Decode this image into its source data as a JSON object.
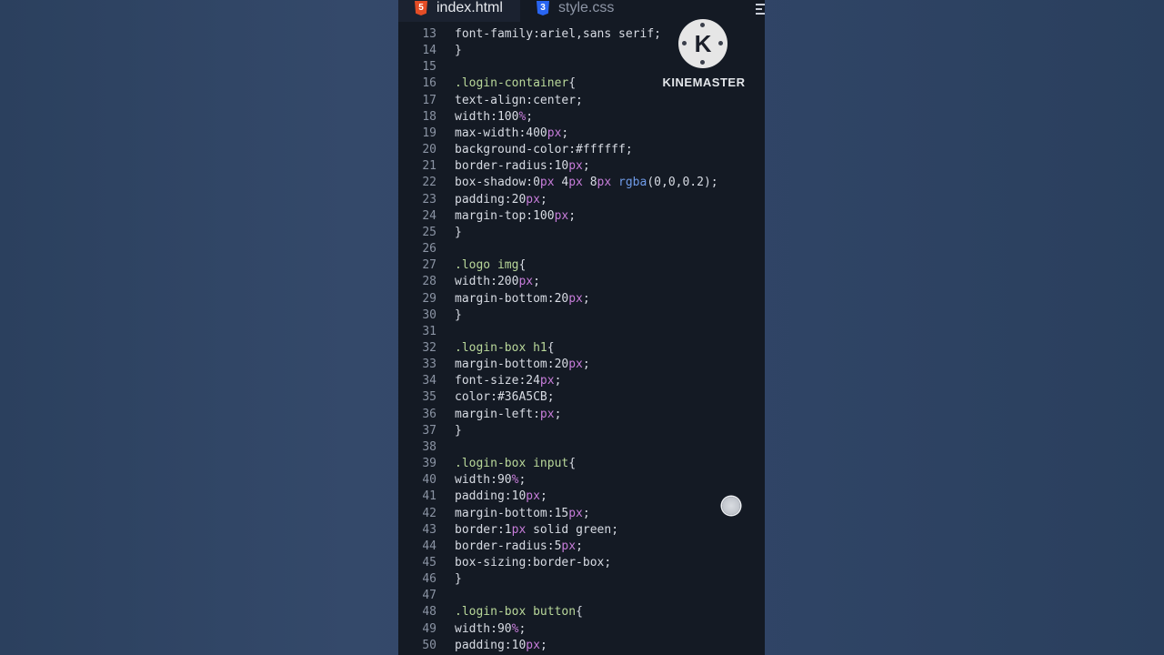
{
  "tabs": [
    {
      "label": "index.html",
      "icon": "html5-icon",
      "active": true
    },
    {
      "label": "style.css",
      "icon": "css3-icon",
      "active": false
    }
  ],
  "watermark": {
    "label": "KINEMASTER",
    "logo_letter": "K"
  },
  "code_lines": [
    {
      "n": "13",
      "tokens": [
        {
          "t": "font-family:ariel,sans serif;",
          "c": ""
        }
      ]
    },
    {
      "n": "14",
      "tokens": [
        {
          "t": "}",
          "c": ""
        }
      ]
    },
    {
      "n": "15",
      "tokens": []
    },
    {
      "n": "16",
      "tokens": [
        {
          "t": ".login-container",
          "c": "sel"
        },
        {
          "t": "{",
          "c": ""
        }
      ]
    },
    {
      "n": "17",
      "tokens": [
        {
          "t": "text-align:center;",
          "c": ""
        }
      ]
    },
    {
      "n": "18",
      "tokens": [
        {
          "t": "width:100",
          "c": ""
        },
        {
          "t": "%",
          "c": "unit"
        },
        {
          "t": ";",
          "c": ""
        }
      ]
    },
    {
      "n": "19",
      "tokens": [
        {
          "t": "max-width:400",
          "c": ""
        },
        {
          "t": "px",
          "c": "unit"
        },
        {
          "t": ";",
          "c": ""
        }
      ]
    },
    {
      "n": "20",
      "tokens": [
        {
          "t": "background-color:#ffffff;",
          "c": ""
        }
      ]
    },
    {
      "n": "21",
      "tokens": [
        {
          "t": "border-radius:10",
          "c": ""
        },
        {
          "t": "px",
          "c": "unit"
        },
        {
          "t": ";",
          "c": ""
        }
      ]
    },
    {
      "n": "22",
      "tokens": [
        {
          "t": "box-shadow:0",
          "c": ""
        },
        {
          "t": "px",
          "c": "unit"
        },
        {
          "t": " 4",
          "c": ""
        },
        {
          "t": "px",
          "c": "unit"
        },
        {
          "t": " 8",
          "c": ""
        },
        {
          "t": "px",
          "c": "unit"
        },
        {
          "t": " ",
          "c": ""
        },
        {
          "t": "rgba",
          "c": "fn"
        },
        {
          "t": "(0,0,0.2);",
          "c": ""
        }
      ]
    },
    {
      "n": "23",
      "tokens": [
        {
          "t": "padding:20",
          "c": ""
        },
        {
          "t": "px",
          "c": "unit"
        },
        {
          "t": ";",
          "c": ""
        }
      ]
    },
    {
      "n": "24",
      "tokens": [
        {
          "t": "margin-top:100",
          "c": ""
        },
        {
          "t": "px",
          "c": "unit"
        },
        {
          "t": ";",
          "c": ""
        }
      ]
    },
    {
      "n": "25",
      "tokens": [
        {
          "t": "}",
          "c": ""
        }
      ]
    },
    {
      "n": "26",
      "tokens": []
    },
    {
      "n": "27",
      "tokens": [
        {
          "t": ".logo img",
          "c": "sel"
        },
        {
          "t": "{",
          "c": ""
        }
      ]
    },
    {
      "n": "28",
      "tokens": [
        {
          "t": "width:200",
          "c": ""
        },
        {
          "t": "px",
          "c": "unit"
        },
        {
          "t": ";",
          "c": ""
        }
      ]
    },
    {
      "n": "29",
      "tokens": [
        {
          "t": "margin-bottom:20",
          "c": ""
        },
        {
          "t": "px",
          "c": "unit"
        },
        {
          "t": ";",
          "c": ""
        }
      ]
    },
    {
      "n": "30",
      "tokens": [
        {
          "t": "}",
          "c": ""
        }
      ]
    },
    {
      "n": "31",
      "tokens": []
    },
    {
      "n": "32",
      "tokens": [
        {
          "t": ".login-box h1",
          "c": "sel"
        },
        {
          "t": "{",
          "c": ""
        }
      ]
    },
    {
      "n": "33",
      "tokens": [
        {
          "t": "margin-bottom:20",
          "c": ""
        },
        {
          "t": "px",
          "c": "unit"
        },
        {
          "t": ";",
          "c": ""
        }
      ]
    },
    {
      "n": "34",
      "tokens": [
        {
          "t": "font-size:24",
          "c": ""
        },
        {
          "t": "px",
          "c": "unit"
        },
        {
          "t": ";",
          "c": ""
        }
      ]
    },
    {
      "n": "35",
      "tokens": [
        {
          "t": "color:#36A5CB;",
          "c": ""
        }
      ]
    },
    {
      "n": "36",
      "tokens": [
        {
          "t": "margin-left:",
          "c": ""
        },
        {
          "t": "px",
          "c": "unit"
        },
        {
          "t": ";",
          "c": ""
        }
      ]
    },
    {
      "n": "37",
      "tokens": [
        {
          "t": "}",
          "c": ""
        }
      ]
    },
    {
      "n": "38",
      "tokens": []
    },
    {
      "n": "39",
      "tokens": [
        {
          "t": ".login-box input",
          "c": "sel"
        },
        {
          "t": "{",
          "c": ""
        }
      ]
    },
    {
      "n": "40",
      "tokens": [
        {
          "t": "width:90",
          "c": ""
        },
        {
          "t": "%",
          "c": "unit"
        },
        {
          "t": ";",
          "c": ""
        }
      ]
    },
    {
      "n": "41",
      "tokens": [
        {
          "t": "padding:10",
          "c": ""
        },
        {
          "t": "px",
          "c": "unit"
        },
        {
          "t": ";",
          "c": ""
        }
      ]
    },
    {
      "n": "42",
      "tokens": [
        {
          "t": "margin-bottom:15",
          "c": ""
        },
        {
          "t": "px",
          "c": "unit"
        },
        {
          "t": ";",
          "c": ""
        }
      ]
    },
    {
      "n": "43",
      "tokens": [
        {
          "t": "border:1",
          "c": ""
        },
        {
          "t": "px",
          "c": "unit"
        },
        {
          "t": " solid green;",
          "c": ""
        }
      ]
    },
    {
      "n": "44",
      "tokens": [
        {
          "t": "border-radius:5",
          "c": ""
        },
        {
          "t": "px",
          "c": "unit"
        },
        {
          "t": ";",
          "c": ""
        }
      ]
    },
    {
      "n": "45",
      "tokens": [
        {
          "t": "box-sizing:border-box;",
          "c": ""
        }
      ]
    },
    {
      "n": "46",
      "tokens": [
        {
          "t": "}",
          "c": ""
        }
      ]
    },
    {
      "n": "47",
      "tokens": []
    },
    {
      "n": "48",
      "tokens": [
        {
          "t": ".login-box button",
          "c": "sel"
        },
        {
          "t": "{",
          "c": ""
        }
      ]
    },
    {
      "n": "49",
      "tokens": [
        {
          "t": "width:90",
          "c": ""
        },
        {
          "t": "%",
          "c": "unit"
        },
        {
          "t": ";",
          "c": ""
        }
      ]
    },
    {
      "n": "50",
      "tokens": [
        {
          "t": "padding:10",
          "c": ""
        },
        {
          "t": "px",
          "c": "unit"
        },
        {
          "t": ";",
          "c": ""
        }
      ]
    }
  ]
}
